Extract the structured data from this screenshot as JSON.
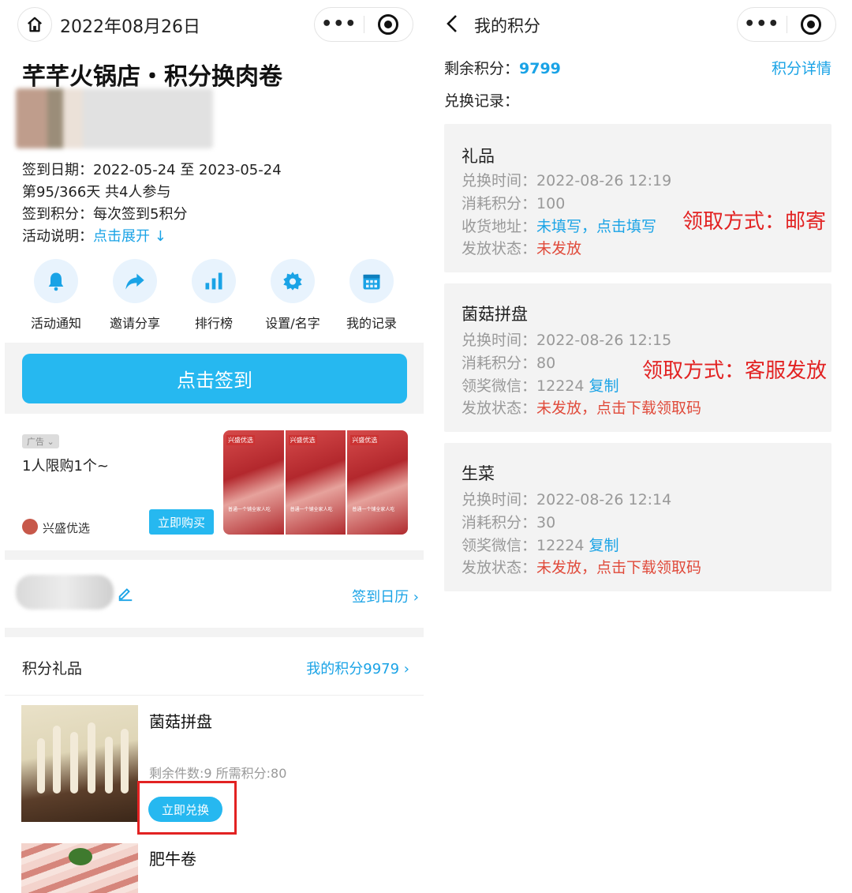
{
  "left": {
    "header": {
      "date": "2022年08月26日"
    },
    "title": "芊芊火锅店・积分换肉卷",
    "info": {
      "checkin_date_label": "签到日期：",
      "checkin_date_value": "2022-05-24 至 2023-05-24",
      "progress": "第95/366天 共4人参与",
      "points_label": "签到积分：",
      "points_value": "每次签到5积分",
      "desc_label": "活动说明：",
      "desc_link": "点击展开 ↓"
    },
    "icons": [
      {
        "label": "活动通知",
        "icon": "bell-icon"
      },
      {
        "label": "邀请分享",
        "icon": "share-icon"
      },
      {
        "label": "排行榜",
        "icon": "chart-icon"
      },
      {
        "label": "设置/名字",
        "icon": "gear-icon"
      },
      {
        "label": "我的记录",
        "icon": "calendar-icon"
      }
    ],
    "checkin_button": "点击签到",
    "ad": {
      "tag": "广告 ⌄",
      "text": "1人限购1个~",
      "brand": "兴盛优选",
      "buy_button": "立即购买",
      "image_badge": "兴盛优选",
      "image_caption": "普通一个铺全家人吃"
    },
    "calendar_link": "签到日历 ›",
    "gifts": {
      "section_title": "积分礼品",
      "my_points_link": "我的积分9979 ›",
      "items": [
        {
          "name": "菌菇拼盘",
          "meta": "剩余件数:9 所需积分:80",
          "button": "立即兑换"
        },
        {
          "name": "肥牛卷"
        }
      ]
    }
  },
  "right": {
    "header": {
      "title": "我的积分"
    },
    "remaining_label": "剩余积分：",
    "remaining_value": "9799",
    "detail_link": "积分详情",
    "records_label": "兑换记录：",
    "records": [
      {
        "title": "礼品",
        "time_label": "兑换时间：",
        "time": "2022-08-26 12:19",
        "cost_label": "消耗积分：",
        "cost": "100",
        "addr_label": "收货地址：",
        "addr": "未填写，点击填写",
        "status_label": "发放状态：",
        "status": "未发放"
      },
      {
        "title": "菌菇拼盘",
        "time_label": "兑换时间：",
        "time": "2022-08-26 12:15",
        "cost_label": "消耗积分：",
        "cost": "80",
        "wx_label": "领奖微信：",
        "wx": "12224",
        "copy": "复制",
        "status_label": "发放状态：",
        "status": "未发放，点击下载领取码"
      },
      {
        "title": "生菜",
        "time_label": "兑换时间：",
        "time": "2022-08-26 12:14",
        "cost_label": "消耗积分：",
        "cost": "30",
        "wx_label": "领奖微信：",
        "wx": "12224",
        "copy": "复制",
        "status_label": "发放状态：",
        "status": "未发放，点击下载领取码"
      }
    ],
    "annotations": {
      "mail": "领取方式：邮寄",
      "service": "领取方式：客服发放"
    }
  },
  "colors": {
    "accent": "#26b8f0",
    "link": "#1aa3e6",
    "warning": "#e04a3a",
    "annotation": "#e22222"
  }
}
